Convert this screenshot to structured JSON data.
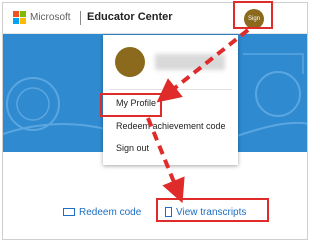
{
  "header": {
    "brand": "Microsoft",
    "app_title": "Educator Center",
    "avatar_initials": "Sign"
  },
  "profile_menu": {
    "items": [
      {
        "label": "My Profile"
      },
      {
        "label": "Redeem achievement code"
      },
      {
        "label": "Sign out"
      }
    ]
  },
  "actions": {
    "redeem_label": "Redeem code",
    "transcripts_label": "View transcripts"
  },
  "icons": {
    "redeem": "code-box-icon",
    "transcripts": "document-icon"
  },
  "colors": {
    "accent": "#1e6fc4",
    "hero": "#2f8ad0",
    "highlight": "#e02b2b",
    "avatar": "#8b6a1e"
  }
}
